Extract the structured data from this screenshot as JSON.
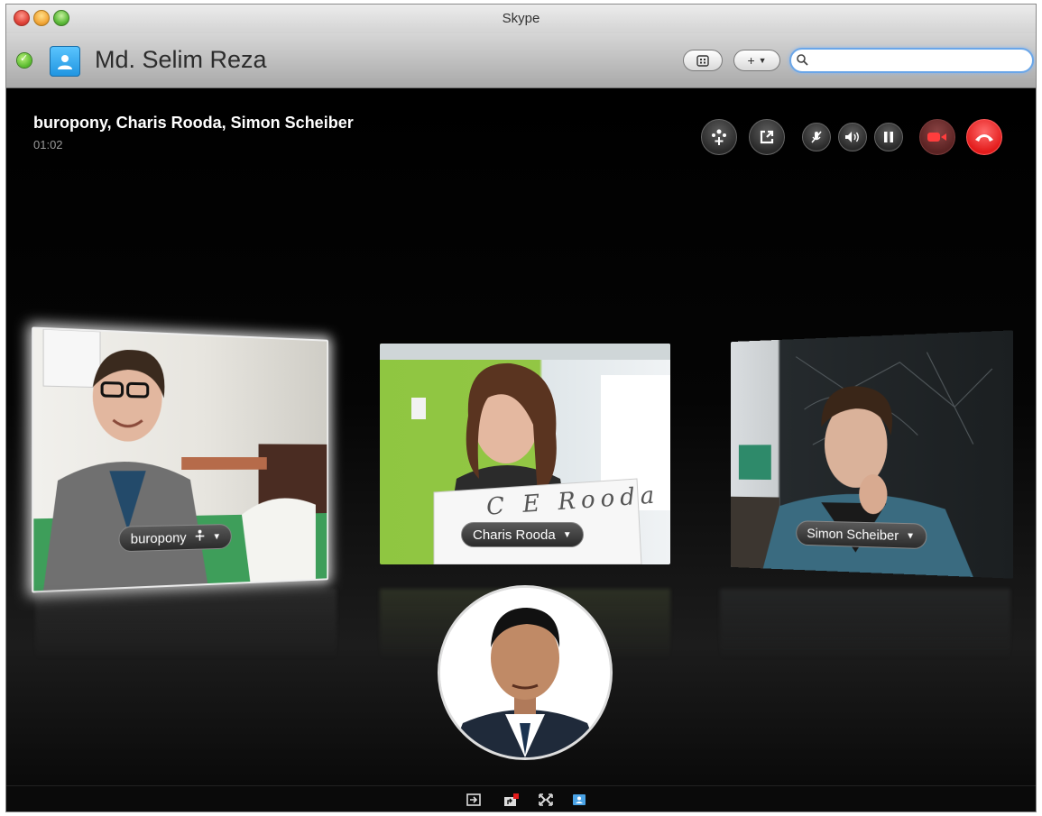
{
  "window": {
    "title": "Skype"
  },
  "toolbar": {
    "user_name": "Md. Selim Reza",
    "add_label": "+",
    "search_value": "",
    "icons": {
      "status": "online-check-icon",
      "avatar": "contact-avatar-icon",
      "dial": "dialpad-icon",
      "add": "plus-dropdown-icon",
      "search": "search-icon"
    }
  },
  "call": {
    "participants": "buropony, Charis Rooda, Simon Scheiber",
    "timer": "01:02",
    "controls": [
      "add-participant-icon",
      "popout-icon",
      "mute-mic-icon",
      "volume-icon",
      "pause-icon",
      "video-camera-icon",
      "hang-up-icon"
    ],
    "tiles": [
      {
        "name": "buropony",
        "has_host_icon": true
      },
      {
        "name": "Charis Rooda"
      },
      {
        "name": "Simon Scheiber"
      }
    ],
    "whiteboard_text": "C E Rooda"
  },
  "bottom_bar": {
    "icons": [
      "enter-icon",
      "share-screen-icon",
      "fullscreen-icon",
      "contacts-icon"
    ]
  },
  "colors": {
    "hangup_red": "#e31c1c",
    "window_bg": "#000000",
    "search_focus": "#6aa6e8"
  }
}
